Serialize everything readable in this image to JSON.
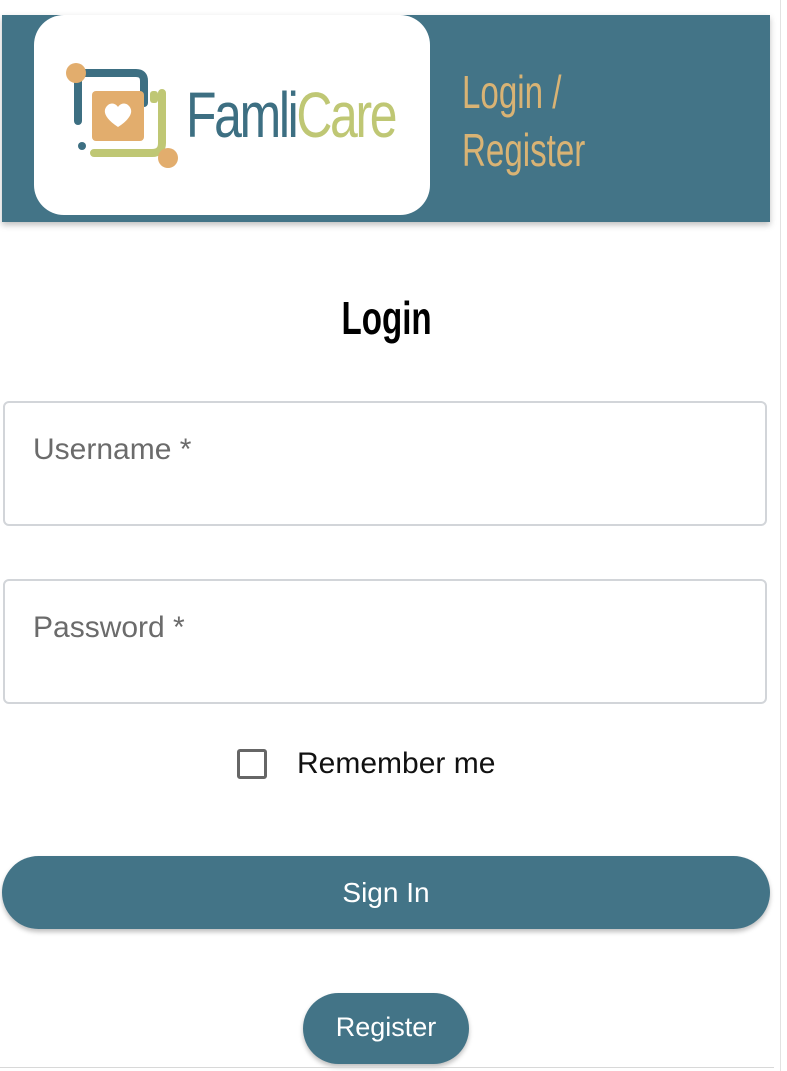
{
  "header": {
    "logo_text_famli": "Famli",
    "logo_text_care": "Care",
    "title_line1": "Login /",
    "title_line2": "Register",
    "background_color": "#437487",
    "title_color": "#d9b374"
  },
  "login": {
    "heading": "Login",
    "username_label": "Username *",
    "username_value": "",
    "password_label": "Password *",
    "password_value": "",
    "remember_label": "Remember me",
    "remember_checked": false,
    "signin_label": "Sign In",
    "register_label": "Register",
    "button_color": "#437487"
  },
  "icons": {
    "logo": "famlicare-logo-icon",
    "heart": "heart-icon"
  }
}
